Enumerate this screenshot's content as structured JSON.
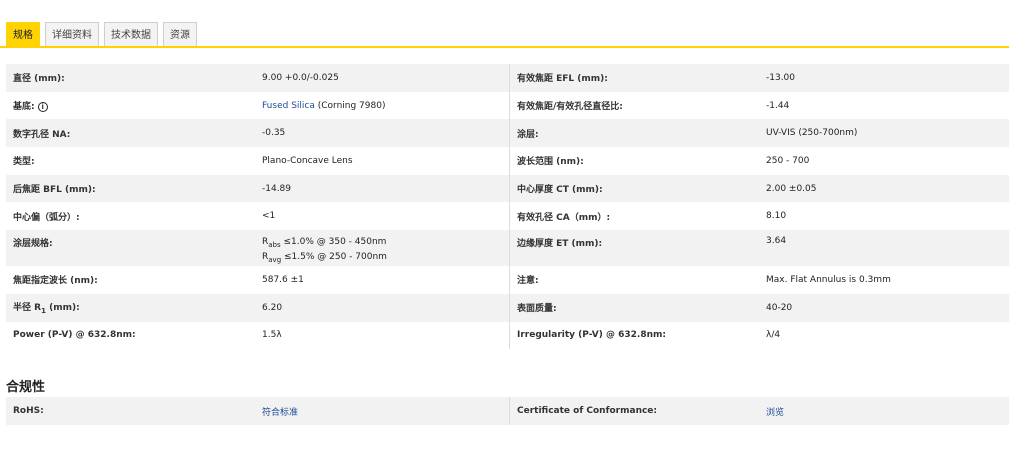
{
  "tabs": [
    "规格",
    "详细资料",
    "技术数据",
    "资源"
  ],
  "specs": {
    "r1": {
      "l1": "直径 (mm):",
      "v1": "9.00 +0.0/-0.025",
      "l2": "有效焦距 EFL (mm):",
      "v2": "-13.00"
    },
    "r2": {
      "l1": "基底:",
      "v1_link": "Fused Silica",
      "v1_rest": " (Corning 7980)",
      "l2": "有效焦距/有效孔径直径比:",
      "v2": "-1.44"
    },
    "r3": {
      "l1": "数字孔径 NA:",
      "v1": "-0.35",
      "l2": "涂层:",
      "v2": "UV-VIS (250-700nm)"
    },
    "r4": {
      "l1": "类型:",
      "v1": "Plano-Concave Lens",
      "l2": "波长范围 (nm):",
      "v2": "250 - 700"
    },
    "r5": {
      "l1": "后焦距 BFL (mm):",
      "v1": "-14.89",
      "l2": "中心厚度 CT (mm):",
      "v2": "2.00 ±0.05"
    },
    "r6": {
      "l1": "中心偏（弧分）:",
      "v1": "<1",
      "l2": "有效孔径 CA（mm）:",
      "v2": "8.10"
    },
    "r7": {
      "l1": "涂层规格:",
      "v1a_sub": "abs",
      "v1a_rest": " ≤1.0% @ 350 - 450nm",
      "v1b_sub": "avg",
      "v1b_rest": " ≤1.5% @ 250 - 700nm",
      "r": "R",
      "l2": "边缘厚度 ET (mm):",
      "v2": "3.64"
    },
    "r8": {
      "l1": "焦距指定波长 (nm):",
      "v1": "587.6 ±1",
      "l2": "注意:",
      "v2": "Max. Flat Annulus is 0.3mm"
    },
    "r9": {
      "l1_pre": "半径 R",
      "l1_sub": "1",
      "l1_post": " (mm):",
      "v1": "6.20",
      "l2": "表面质量:",
      "v2": "40-20"
    },
    "r10": {
      "l1": "Power (P-V) @ 632.8nm:",
      "v1": "1.5λ",
      "l2": "Irregularity (P-V) @ 632.8nm:",
      "v2": "λ/4"
    }
  },
  "compliance": {
    "title": "合规性",
    "l1": "RoHS:",
    "v1": "符合标准",
    "l2": "Certificate of Conformance:",
    "v2": "浏览"
  },
  "colors": {
    "accent": "#ffd300",
    "link": "#1f4e96"
  }
}
